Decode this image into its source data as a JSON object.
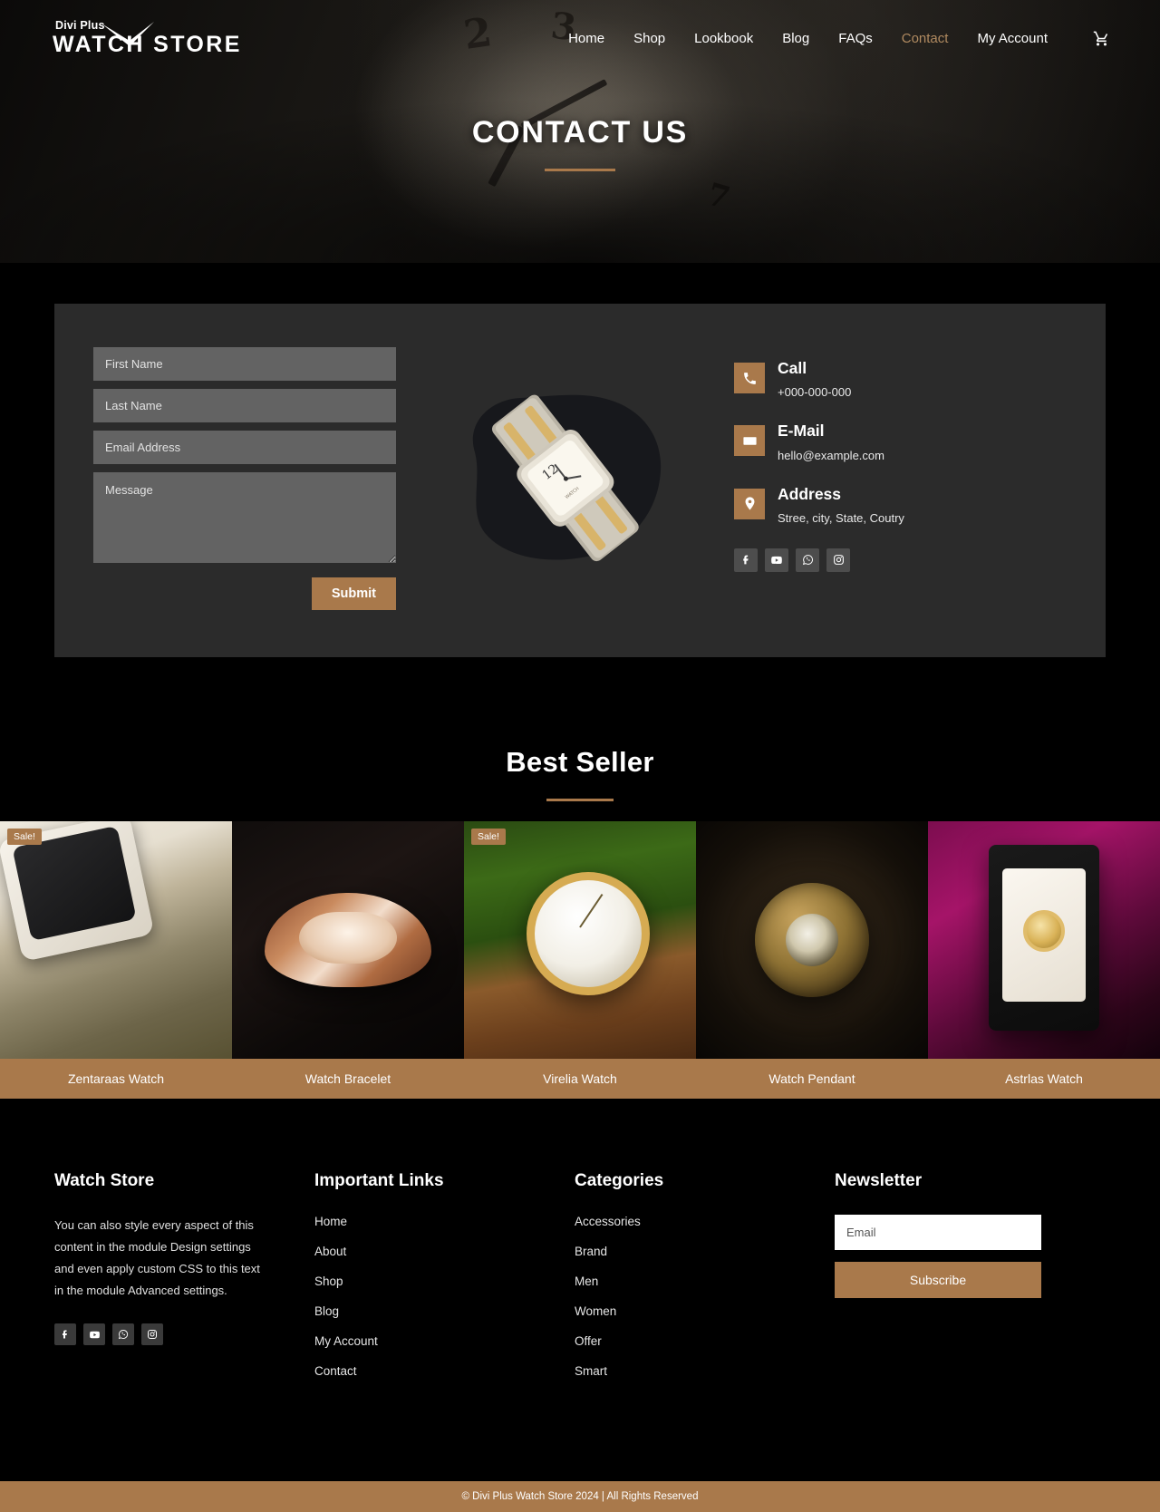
{
  "brand": {
    "logo_top": "Divi Plus",
    "logo_main": "WATCH STORE"
  },
  "nav": {
    "items": [
      {
        "label": "Home",
        "active": false
      },
      {
        "label": "Shop",
        "active": false
      },
      {
        "label": "Lookbook",
        "active": false
      },
      {
        "label": "Blog",
        "active": false
      },
      {
        "label": "FAQs",
        "active": false
      },
      {
        "label": "Contact",
        "active": true
      },
      {
        "label": "My Account",
        "active": false
      }
    ],
    "cart_icon": "shopping-cart-icon"
  },
  "hero": {
    "title": "CONTACT US"
  },
  "contact_form": {
    "first_name_placeholder": "First Name",
    "last_name_placeholder": "Last Name",
    "email_placeholder": "Email Address",
    "message_placeholder": "Message",
    "submit_label": "Submit"
  },
  "contact_info": [
    {
      "icon": "phone-icon",
      "title": "Call",
      "text": "+000-000-000"
    },
    {
      "icon": "envelope-icon",
      "title": "E-Mail",
      "text": "hello@example.com"
    },
    {
      "icon": "map-pin-icon",
      "title": "Address",
      "text": "Stree, city, State, Coutry"
    }
  ],
  "contact_socials": [
    "facebook-icon",
    "youtube-icon",
    "whatsapp-icon",
    "instagram-icon"
  ],
  "best_seller": {
    "title": "Best Seller",
    "products": [
      {
        "name": "Zentaraas Watch",
        "sale": true,
        "sale_label": "Sale!"
      },
      {
        "name": "Watch Bracelet",
        "sale": false,
        "sale_label": ""
      },
      {
        "name": "Virelia Watch",
        "sale": true,
        "sale_label": "Sale!"
      },
      {
        "name": "Watch Pendant",
        "sale": false,
        "sale_label": ""
      },
      {
        "name": "Astrlas Watch",
        "sale": false,
        "sale_label": ""
      }
    ]
  },
  "footer": {
    "about": {
      "title": "Watch Store",
      "text": "You can also style every aspect of this content in the module Design settings and even apply custom CSS to this text in the module Advanced settings.",
      "socials": [
        "facebook-icon",
        "youtube-icon",
        "whatsapp-icon",
        "instagram-icon"
      ]
    },
    "links": {
      "title": "Important Links",
      "items": [
        "Home",
        "About",
        "Shop",
        "Blog",
        "My Account",
        "Contact"
      ]
    },
    "categories": {
      "title": "Categories",
      "items": [
        "Accessories",
        "Brand",
        "Men",
        "Women",
        "Offer",
        "Smart"
      ]
    },
    "newsletter": {
      "title": "Newsletter",
      "email_placeholder": "Email",
      "button_label": "Subscribe"
    },
    "copyright": "© Divi Plus Watch Store 2024 | All Rights Reserved"
  },
  "colors": {
    "accent": "#a9794b",
    "panel": "#2b2b2b",
    "field": "#636363",
    "page_bg": "#000000"
  }
}
